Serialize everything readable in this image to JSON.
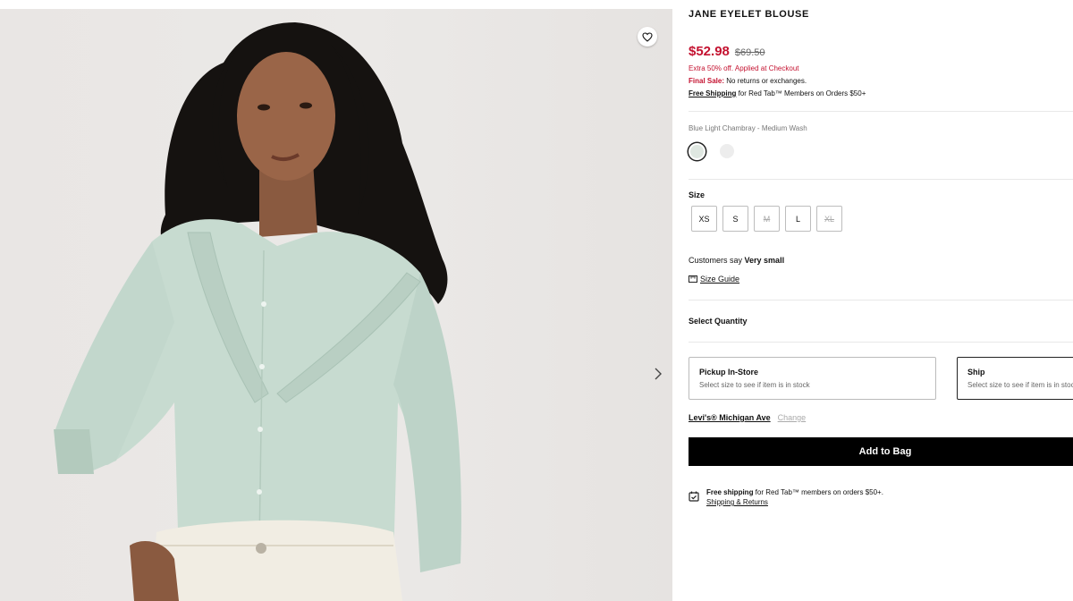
{
  "product": {
    "title": "JANE EYELET BLOUSE",
    "sale_price": "$52.98",
    "original_price": "$69.50",
    "promo": "Extra 50% off. Applied at Checkout",
    "final_sale_label": "Final Sale:",
    "final_sale_text": " No returns or exchanges.",
    "free_shipping_link": "Free Shipping",
    "free_shipping_text": " for Red Tab™ Members on Orders $50+"
  },
  "color": {
    "selected_name": "Blue Light Chambray - Medium Wash",
    "swatches": [
      {
        "name": "Blue Light Chambray - Medium Wash",
        "hex": "#dfe7e1",
        "selected": true
      },
      {
        "name": "white",
        "hex": "#ededed",
        "selected": false
      }
    ]
  },
  "size": {
    "label": "Size",
    "options": [
      {
        "label": "XS",
        "available": true
      },
      {
        "label": "S",
        "available": true
      },
      {
        "label": "M",
        "available": false
      },
      {
        "label": "L",
        "available": true
      },
      {
        "label": "XL",
        "available": false
      }
    ],
    "fit_prefix": "Customers say ",
    "fit_value": "Very small",
    "size_guide": "Size Guide"
  },
  "quantity": {
    "label": "Select Quantity"
  },
  "fulfillment": {
    "pickup": {
      "title": "Pickup In-Store",
      "subtitle": "Select size to see if item is in stock"
    },
    "ship": {
      "title": "Ship",
      "subtitle": "Select size to see if item is in stock"
    },
    "store_name": "Levi's® Michigan Ave",
    "change": "Change"
  },
  "cta": {
    "add_to_bag": "Add to Bag"
  },
  "shipping_info": {
    "bold": "Free shipping",
    "text": " for Red Tab™ members on orders $50+.",
    "link": "Shipping & Returns"
  },
  "colors": {
    "sale_red": "#c41230",
    "button_black": "#000000",
    "shirt_mint": "#c9dcd2"
  },
  "icons": {
    "favorite": "heart-icon",
    "next": "chevron-right-icon",
    "size_guide": "ruler-icon",
    "shipping": "calendar-box-icon"
  }
}
